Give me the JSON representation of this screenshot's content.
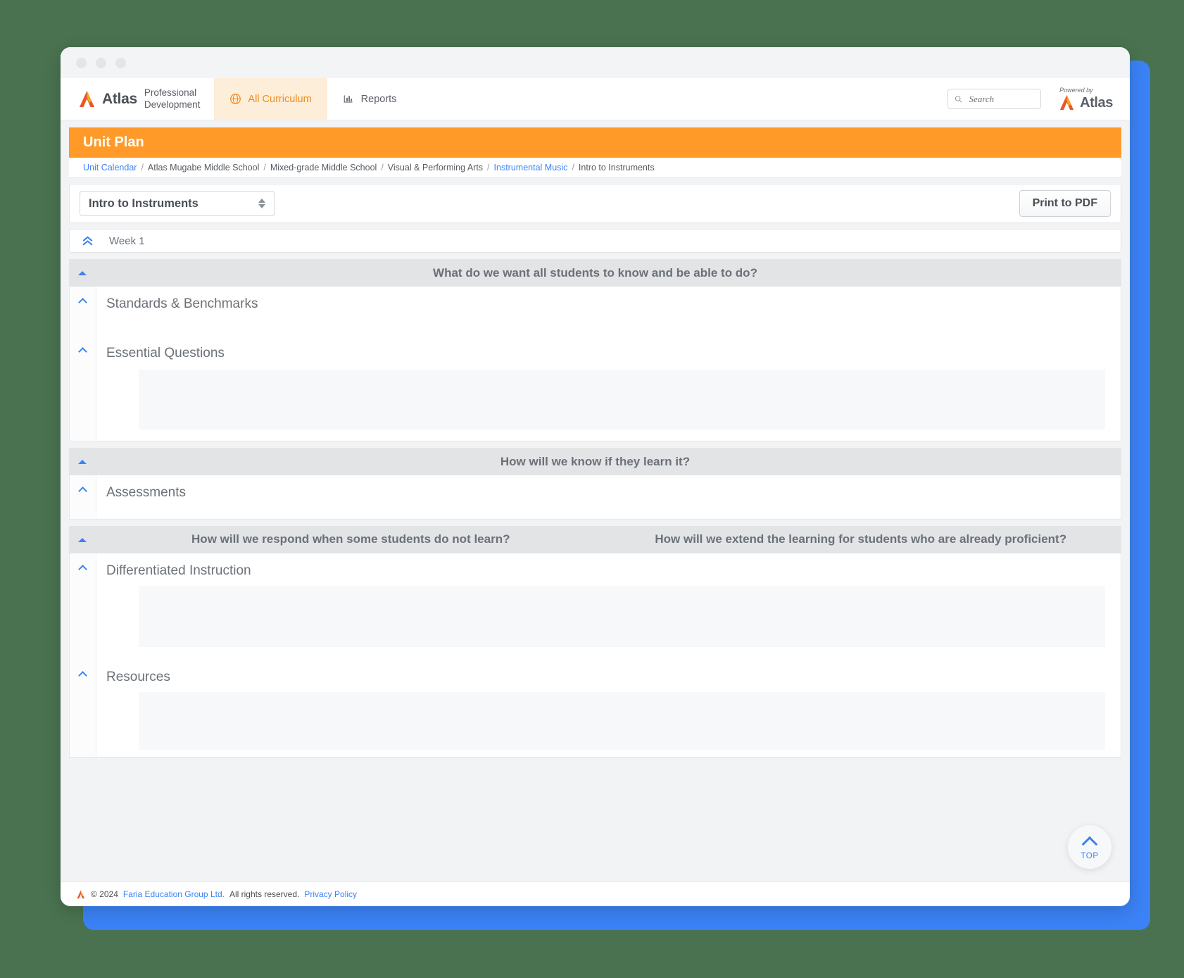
{
  "window": {
    "dots": [
      "close-dot",
      "minimize-dot",
      "maximize-dot"
    ]
  },
  "header": {
    "logo_word": "Atlas",
    "product_line1": "Professional",
    "product_line2": "Development",
    "nav": [
      {
        "label": "All Curriculum",
        "icon": "globe-icon",
        "active": true
      },
      {
        "label": "Reports",
        "icon": "bar-chart-icon",
        "active": false
      }
    ],
    "search": {
      "placeholder": "Search",
      "value": "",
      "icon": "search-icon"
    },
    "powered_by_label": "Powered by",
    "powered_by_word": "Atlas"
  },
  "page": {
    "title": "Unit Plan",
    "title_bg": "#ff9a29"
  },
  "breadcrumb": {
    "separator": "/",
    "items": [
      {
        "label": "Unit Calendar",
        "link": true
      },
      {
        "label": "Atlas Mugabe Middle School",
        "link": false
      },
      {
        "label": "Mixed-grade Middle School",
        "link": false
      },
      {
        "label": "Visual & Performing Arts",
        "link": false
      },
      {
        "label": "Instrumental Music",
        "link": true
      },
      {
        "label": "Intro to Instruments",
        "link": false
      }
    ]
  },
  "toolbar": {
    "unit_select_value": "Intro to Instruments",
    "unit_select_options": [
      "Intro to Instruments"
    ],
    "print_label": "Print to PDF"
  },
  "week": {
    "label": "Week 1",
    "collapse_icon": "double-chevron-up-icon"
  },
  "sections": [
    {
      "title": "What do we want all students to know and be able to do?",
      "two_column": false,
      "toggle_icon": "triangle-up-icon",
      "fields": [
        {
          "label": "Standards & Benchmarks",
          "toggle_icon": "chevron-up-icon",
          "skeleton": false
        },
        {
          "label": "Essential Questions",
          "toggle_icon": "chevron-up-icon",
          "skeleton": true
        }
      ]
    },
    {
      "title": "How will we know if they learn it?",
      "two_column": false,
      "toggle_icon": "triangle-up-icon",
      "fields": [
        {
          "label": "Assessments",
          "toggle_icon": "chevron-up-icon",
          "skeleton": false
        }
      ]
    },
    {
      "title_left": "How will we respond when some students do not learn?",
      "title_right": "How will we extend the learning for students who are already proficient?",
      "two_column": true,
      "toggle_icon": "triangle-up-icon",
      "fields": [
        {
          "label": "Differentiated Instruction",
          "toggle_icon": "chevron-up-icon",
          "skeleton": true
        },
        {
          "label": "Resources",
          "toggle_icon": "chevron-up-icon",
          "skeleton": true
        }
      ]
    }
  ],
  "scroll_top_button": {
    "label": "TOP",
    "icon": "chevron-up-icon"
  },
  "footer": {
    "copyright": "© 2024",
    "company": "Faria Education Group Ltd.",
    "rights": "All rights reserved.",
    "privacy": "Privacy Policy",
    "logo": "atlas-mark-icon"
  },
  "colors": {
    "accent_orange": "#ff9a29",
    "link_blue": "#3b82f6",
    "page_bg_green": "#4a7250",
    "section_head_grey": "#e2e4e6"
  }
}
